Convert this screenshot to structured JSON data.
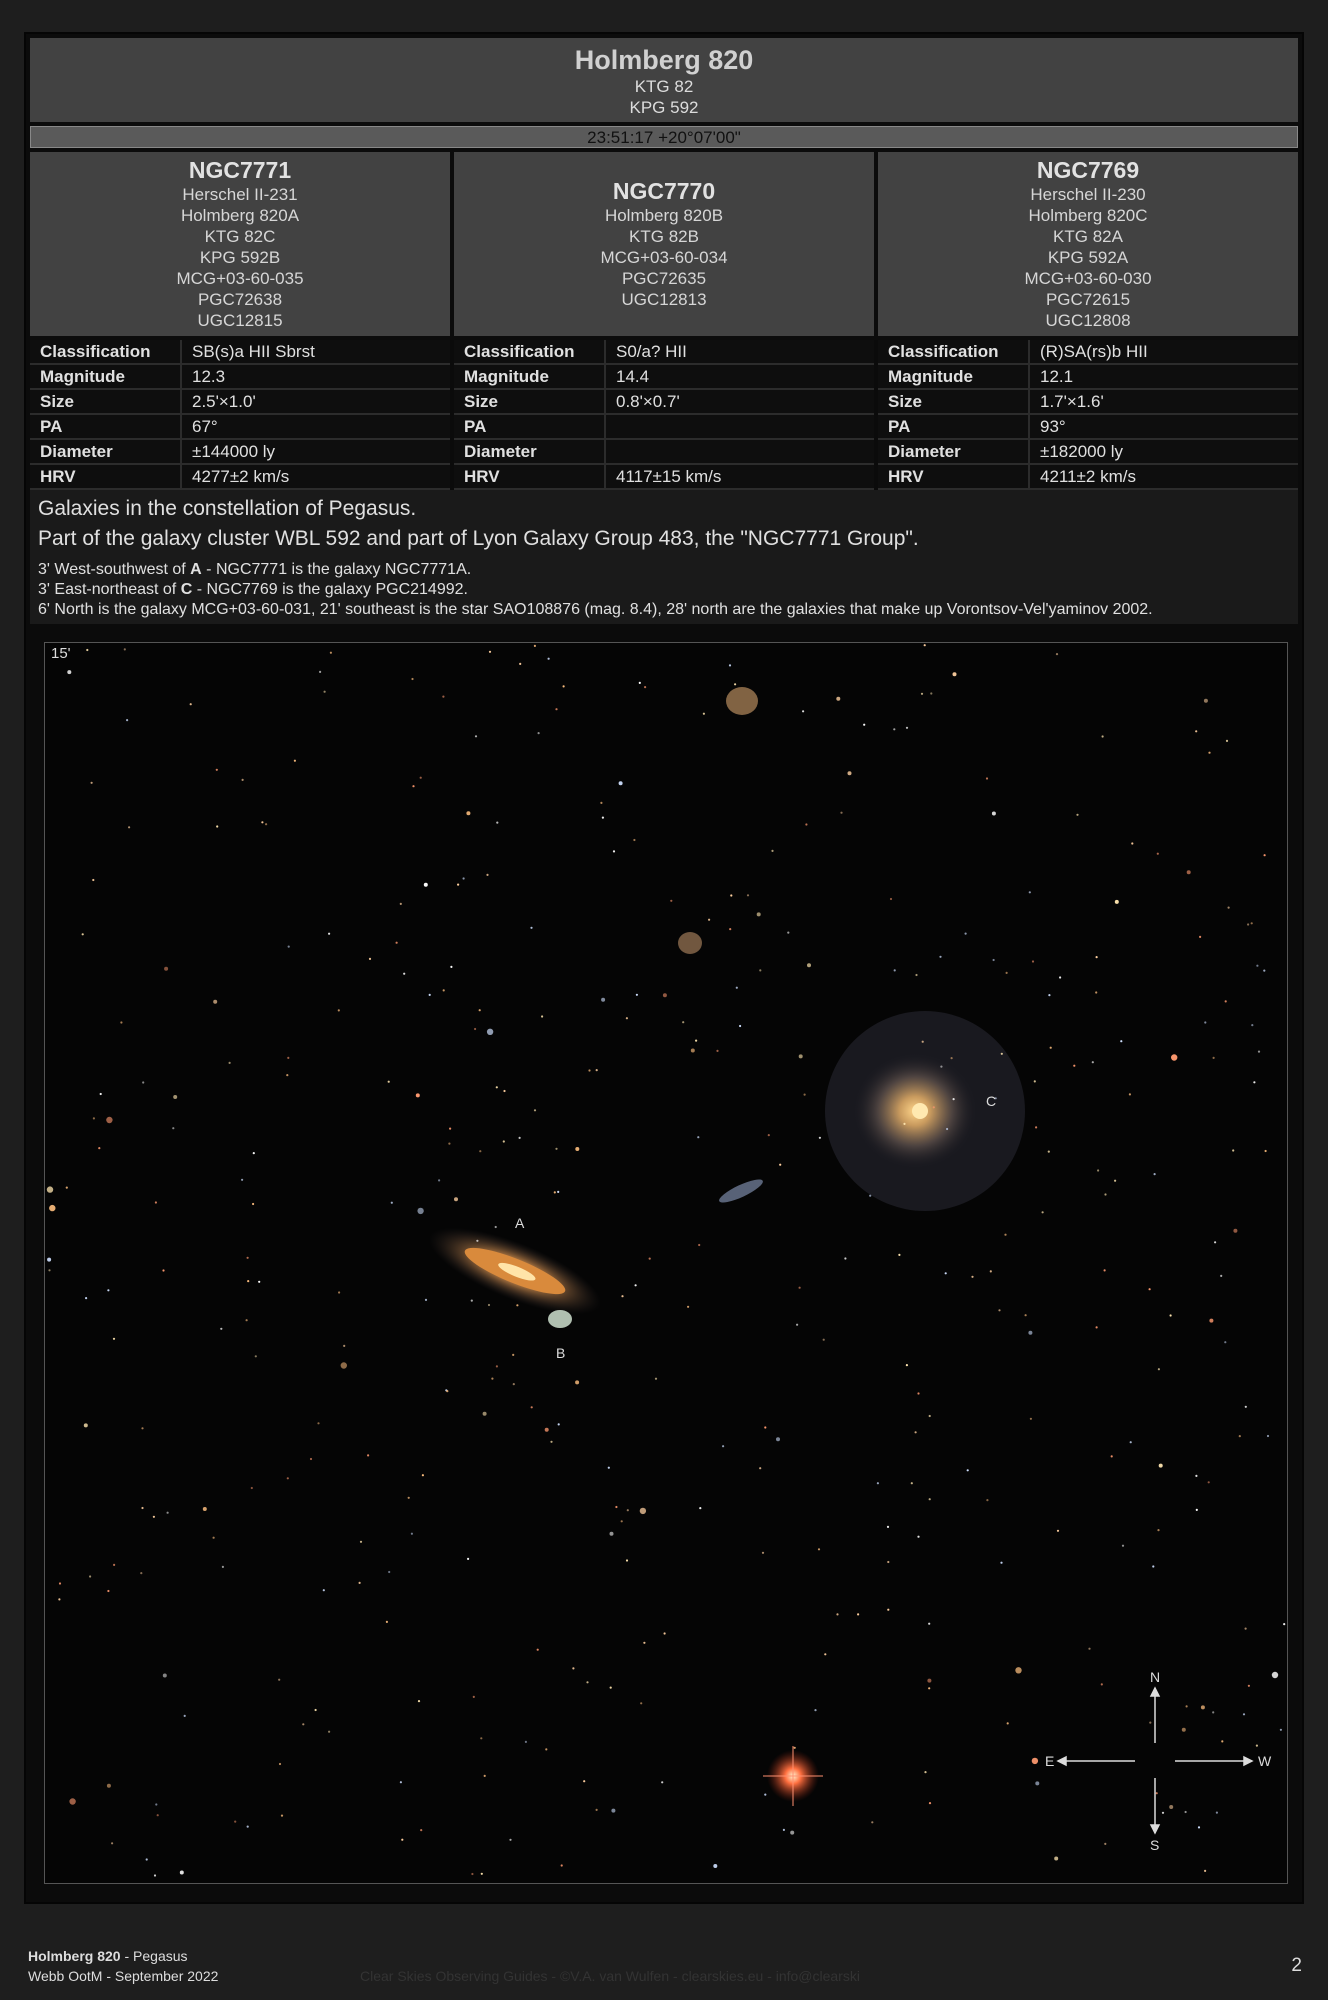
{
  "header": {
    "title": "Holmberg 820",
    "aliases": [
      "KTG 82",
      "KPG 592"
    ],
    "coordinates": "23:51:17 +20°07'00\""
  },
  "galaxies": [
    {
      "name": "NGC7771",
      "aliases": [
        "Herschel II-231",
        "Holmberg 820A",
        "KTG 82C",
        "KPG 592B",
        "MCG+03-60-035",
        "PGC72638",
        "UGC12815"
      ],
      "classification": "SB(s)a HII Sbrst",
      "magnitude": "12.3",
      "size": "2.5'×1.0'",
      "pa": "67°",
      "diameter": "±144000 ly",
      "hrv": "4277±2 km/s"
    },
    {
      "name": "NGC7770",
      "aliases": [
        "Holmberg 820B",
        "KTG 82B",
        "MCG+03-60-034",
        "PGC72635",
        "UGC12813"
      ],
      "classification": "S0/a? HII",
      "magnitude": "14.4",
      "size": "0.8'×0.7'",
      "pa": "",
      "diameter": "",
      "hrv": "4117±15 km/s"
    },
    {
      "name": "NGC7769",
      "aliases": [
        "Herschel II-230",
        "Holmberg 820C",
        "KTG 82A",
        "KPG 592A",
        "MCG+03-60-030",
        "PGC72615",
        "UGC12808"
      ],
      "classification": "(R)SA(rs)b HII",
      "magnitude": "12.1",
      "size": "1.7'×1.6'",
      "pa": "93°",
      "diameter": "±182000 ly",
      "hrv": "4211±2 km/s"
    }
  ],
  "labels": {
    "classification": "Classification",
    "magnitude": "Magnitude",
    "size": "Size",
    "pa": "PA",
    "diameter": "Diameter",
    "hrv": "HRV"
  },
  "notes": {
    "line1": "Galaxies in the constellation of Pegasus.",
    "line2": "Part of the galaxy cluster WBL 592 and part of Lyon Galaxy Group 483, the \"NGC7771 Group\".",
    "n1_pre": "3' West-southwest of ",
    "n1_bold": "A",
    "n1_post": " - NGC7771 is the galaxy NGC7771A.",
    "n2_pre": "3' East-northeast of ",
    "n2_bold": "C",
    "n2_post": " - NGC7769 is the galaxy PGC214992.",
    "n3": "6' North is the galaxy MCG+03-60-031, 21' southeast is the star SAO108876 (mag. 8.4), 28' north are the galaxies that make up Vorontsov-Vel'yaminov 2002."
  },
  "image": {
    "scale": "15'",
    "label_a": "A",
    "label_b": "B",
    "label_c": "C",
    "compass": {
      "n": "N",
      "s": "S",
      "e": "E",
      "w": "W"
    }
  },
  "footer": {
    "title_bold": "Holmberg 820",
    "title_rest": " - Pegasus",
    "line2": "Webb OotM - September 2022",
    "credit": "Clear Skies Observing Guides - ©V.A. van Wulfen - clearskies.eu - info@clearski",
    "page": "2"
  }
}
